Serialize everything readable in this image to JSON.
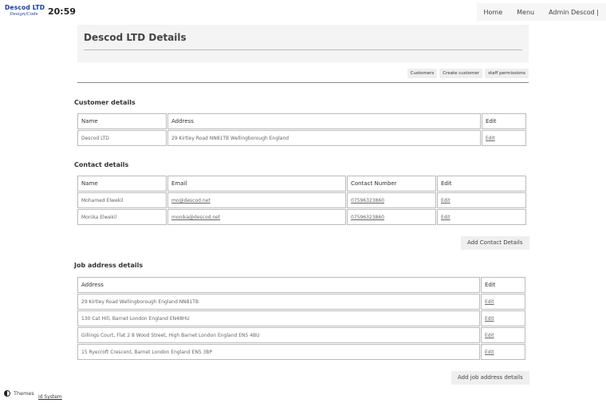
{
  "header": {
    "logo_line1": "Descod LTD",
    "logo_line2": "Design/Code",
    "clock": "20:59",
    "nav": [
      "Home",
      "Menu",
      "Admin Descod |"
    ]
  },
  "page": {
    "title": "Descod LTD Details",
    "subnav": [
      "Customers",
      "Create customer",
      "staff permissions"
    ]
  },
  "customer": {
    "heading": "Customer details",
    "columns": [
      "Name",
      "Address",
      "Edit"
    ],
    "rows": [
      [
        "Descod LTD",
        "29 Kirtley Road NN81TB Wellingborough England",
        "Edit"
      ]
    ]
  },
  "contacts": {
    "heading": "Contact details",
    "columns": [
      "Name",
      "Email",
      "Contact Number",
      "Edit"
    ],
    "rows": [
      [
        "Mohamed Elwekil",
        "mo@descod.net",
        "07596323860",
        "Edit"
      ],
      [
        "Monika Elwekil",
        "monika@descod.net",
        "07596323860",
        "Edit"
      ]
    ],
    "add_button": "Add Contact Details"
  },
  "jobs": {
    "heading": "Job address details",
    "columns": [
      "Address",
      "Edit"
    ],
    "rows": [
      [
        "29 Kirtley Road Wellingborough England NN81TB",
        "Edit"
      ],
      [
        "130 Cat Hill, Barnet London England EN48HU",
        "Edit"
      ],
      [
        "Gillings Court, Flat 2 8 Wood Street, High Barnet London England EN5 4BU",
        "Edit"
      ],
      [
        "15 Ryecroft Crescent, Barnet London England EN5 3BP",
        "Edit"
      ]
    ],
    "add_button": "Add job address details"
  },
  "footer": {
    "themes": "Themes",
    "text": "id System"
  }
}
